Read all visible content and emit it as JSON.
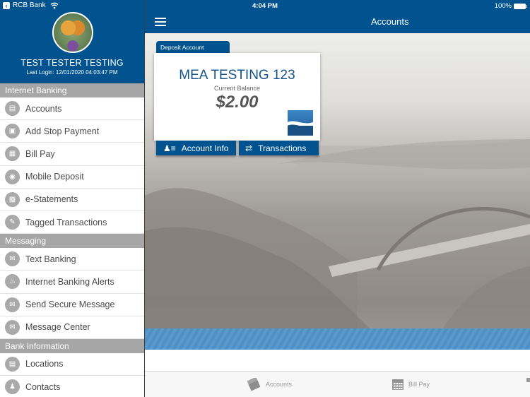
{
  "status_bar": {
    "back_app": "RCB Bank",
    "time": "4:04 PM",
    "battery": "100%"
  },
  "sidebar": {
    "user_name": "TEST TESTER TESTING",
    "last_login": "Last Login: 12/01/2020 04:03:47 PM",
    "sections": [
      {
        "title": "Internet Banking",
        "items": [
          {
            "label": "Accounts",
            "icon": "card-icon"
          },
          {
            "label": "Add Stop Payment",
            "icon": "document-icon"
          },
          {
            "label": "Bill Pay",
            "icon": "calendar-icon"
          },
          {
            "label": "Mobile Deposit",
            "icon": "camera-icon"
          },
          {
            "label": "e-Statements",
            "icon": "statement-icon"
          },
          {
            "label": "Tagged Transactions",
            "icon": "tag-icon"
          }
        ]
      },
      {
        "title": "Messaging",
        "items": [
          {
            "label": "Text Banking",
            "icon": "envelope-icon"
          },
          {
            "label": "Internet Banking Alerts",
            "icon": "bell-icon"
          },
          {
            "label": "Send Secure Message",
            "icon": "envelope-icon"
          },
          {
            "label": "Message Center",
            "icon": "message-center-icon"
          }
        ]
      },
      {
        "title": "Bank Information",
        "items": [
          {
            "label": "Locations",
            "icon": "bank-building-icon"
          },
          {
            "label": "Contacts",
            "icon": "contacts-icon"
          }
        ]
      }
    ]
  },
  "header": {
    "title": "Accounts"
  },
  "account_card": {
    "type_tab": "Deposit Account",
    "name": "MEA TESTING 123",
    "balance_label": "Current Balance",
    "balance": "$2.00",
    "buttons": {
      "info": "Account Info",
      "transactions": "Transactions"
    }
  },
  "tabbar": {
    "items": [
      {
        "label": "Accounts"
      },
      {
        "label": "Bill Pay"
      }
    ]
  },
  "colors": {
    "brand_blue": "#00538e",
    "section_gray": "#a6a6a6",
    "accent_wave": "#5b98cc"
  }
}
